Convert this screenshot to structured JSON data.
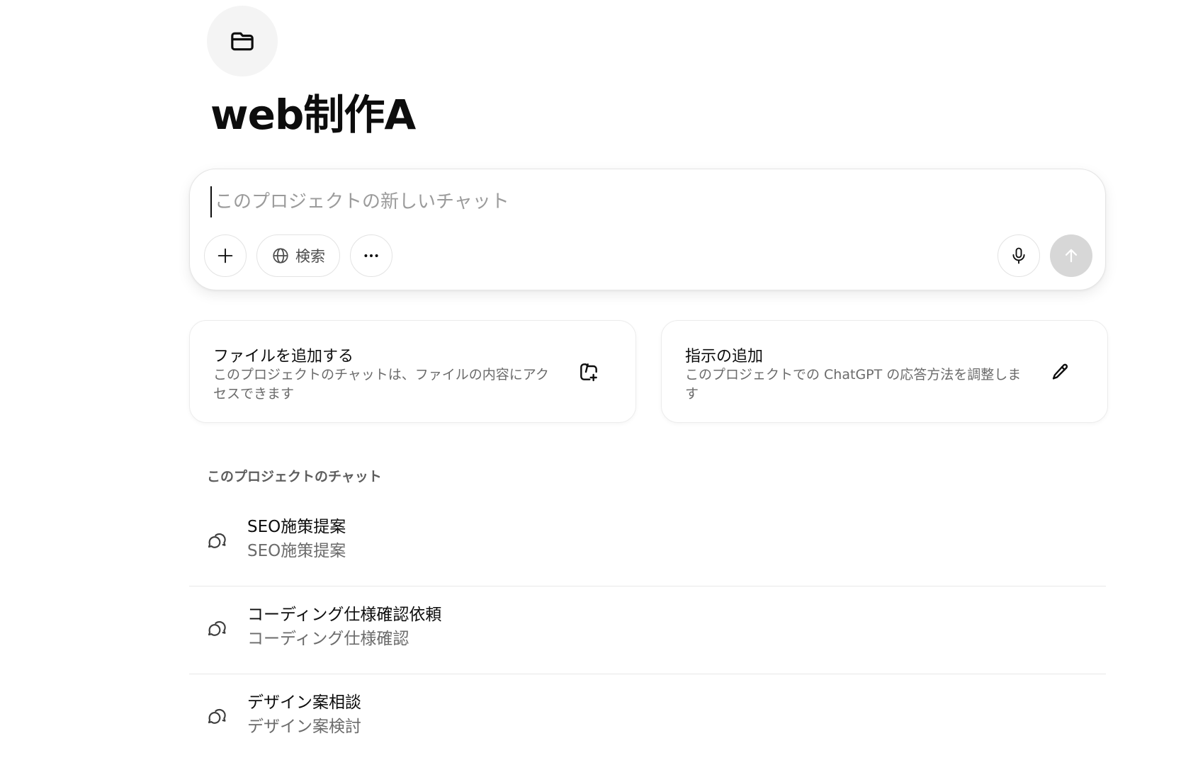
{
  "project": {
    "icon": "folder-icon",
    "title": "web制作A"
  },
  "composer": {
    "placeholder": "このプロジェクトの新しいチャット",
    "value": "",
    "add_icon": "plus-icon",
    "search_icon": "globe-icon",
    "search_label": "検索",
    "more_icon": "ellipsis-icon",
    "mic_icon": "microphone-icon",
    "send_icon": "arrow-up-icon"
  },
  "cards": [
    {
      "title": "ファイルを追加する",
      "description": "このプロジェクトのチャットは、ファイルの内容にアクセスできます",
      "icon": "add-file-icon"
    },
    {
      "title": "指示の追加",
      "description": "このプロジェクトでの ChatGPT の応答方法を調整します",
      "icon": "pencil-icon"
    }
  ],
  "chats": {
    "heading": "このプロジェクトのチャット",
    "icon": "chat-bubbles-icon",
    "items": [
      {
        "title": "SEO施策提案",
        "subtitle": "SEO施策提案"
      },
      {
        "title": "コーディング仕様確認依頼",
        "subtitle": "コーディング仕様確認"
      },
      {
        "title": "デザイン案相談",
        "subtitle": "デザイン案検討"
      }
    ]
  },
  "colors": {
    "send_disabled": "#d7d7d7",
    "badge_background": "#f4f4f4",
    "muted_text": "#6b6b6b"
  }
}
